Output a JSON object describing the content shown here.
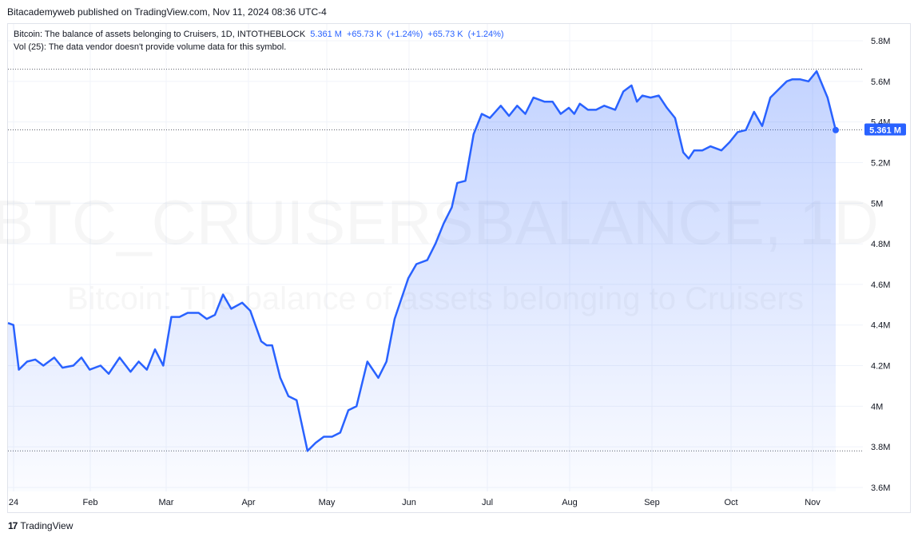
{
  "publisher": "Bitacademyweb published on TradingView.com, Nov 11, 2024 08:36 UTC-4",
  "legend": {
    "title": "Bitcoin: The balance of assets belonging to Cruisers, 1D, INTOTHEBLOCK",
    "last": "5.361 M",
    "change_abs": "+65.73 K",
    "change_pct": "(+1.24%)",
    "change_abs2": "+65.73 K",
    "change_pct2": "(+1.24%)",
    "vol_note": "Vol (25): The data vendor doesn't provide volume data for this symbol."
  },
  "watermark": {
    "line1": "BTC_CRUISERSBALANCE, 1D",
    "line2": "Bitcoin: The balance of assets belonging to Cruisers"
  },
  "last_price_label": "5.361 M",
  "brand": "TradingView",
  "colors": {
    "line": "#2962ff",
    "fill": "#2962ff",
    "grid": "#f0f3fa",
    "axis_text": "#131722",
    "badge": "#2962ff"
  },
  "chart_data": {
    "type": "area",
    "y_ticks": [
      "5.8M",
      "5.6M",
      "5.4M",
      "5.2M",
      "5M",
      "4.8M",
      "4.6M",
      "4.4M",
      "4.2M",
      "4M",
      "3.8M",
      "3.6M"
    ],
    "x_ticks": [
      "24",
      "Feb",
      "Mar",
      "Apr",
      "May",
      "Jun",
      "Jul",
      "Aug",
      "Sep",
      "Oct",
      "Nov"
    ],
    "ylim": [
      3.6,
      5.8
    ],
    "last_value": 5.361,
    "reference_lines": [
      5.66,
      5.361,
      3.78
    ],
    "x": [
      0,
      2,
      4,
      7,
      10,
      13,
      17,
      20,
      24,
      27,
      30,
      34,
      37,
      41,
      45,
      48,
      51,
      54,
      57,
      60,
      63,
      66,
      70,
      73,
      76,
      79,
      82,
      86,
      89,
      93,
      95,
      97,
      100,
      103,
      106,
      110,
      113,
      116,
      119,
      122,
      125,
      128,
      132,
      136,
      139,
      142,
      147,
      150,
      154,
      157,
      160,
      163,
      165,
      168,
      171,
      174,
      177,
      181,
      184,
      187,
      190,
      193,
      197,
      200,
      203,
      206,
      208,
      210,
      213,
      216,
      219,
      223,
      226,
      229,
      231,
      233,
      236,
      239,
      242,
      245,
      248,
      250,
      252,
      255,
      258,
      262,
      265,
      268,
      271,
      274,
      277,
      280,
      283,
      286,
      288,
      291,
      294,
      297,
      301,
      304
    ],
    "y": [
      4.41,
      4.4,
      4.18,
      4.22,
      4.23,
      4.2,
      4.24,
      4.19,
      4.2,
      4.24,
      4.18,
      4.2,
      4.16,
      4.24,
      4.17,
      4.22,
      4.18,
      4.28,
      4.2,
      4.44,
      4.44,
      4.46,
      4.46,
      4.43,
      4.45,
      4.55,
      4.48,
      4.51,
      4.47,
      4.32,
      4.3,
      4.3,
      4.14,
      4.05,
      4.03,
      3.78,
      3.82,
      3.85,
      3.85,
      3.87,
      3.98,
      4.0,
      4.22,
      4.14,
      4.22,
      4.43,
      4.63,
      4.7,
      4.72,
      4.8,
      4.9,
      4.98,
      5.1,
      5.11,
      5.34,
      5.44,
      5.42,
      5.48,
      5.43,
      5.48,
      5.44,
      5.52,
      5.5,
      5.5,
      5.44,
      5.47,
      5.44,
      5.49,
      5.46,
      5.46,
      5.48,
      5.46,
      5.55,
      5.58,
      5.5,
      5.53,
      5.52,
      5.53,
      5.47,
      5.42,
      5.25,
      5.22,
      5.26,
      5.26,
      5.28,
      5.26,
      5.3,
      5.35,
      5.36,
      5.45,
      5.38,
      5.52,
      5.56,
      5.6,
      5.61,
      5.61,
      5.6,
      5.65,
      5.52,
      5.36,
      5.35,
      5.42,
      5.35,
      5.08,
      5.25,
      5.361
    ]
  }
}
